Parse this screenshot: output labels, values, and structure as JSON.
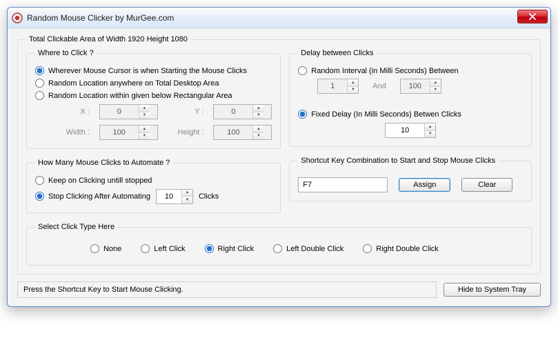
{
  "window": {
    "title": "Random Mouse Clicker by MurGee.com"
  },
  "mainGroup": {
    "legend": "Total Clickable Area of Width 1920 Height 1080"
  },
  "where": {
    "legend": "Where to Click ?",
    "opt1": "Wherever Mouse Cursor is when Starting the Mouse Clicks",
    "opt2": "Random Location anywhere on Total Desktop Area",
    "opt3": "Random Location within given below Rectangular Area",
    "xLabel": "X :",
    "yLabel": "Y :",
    "wLabel": "Width :",
    "hLabel": "Height :",
    "x": "0",
    "y": "0",
    "w": "100",
    "h": "100"
  },
  "delay": {
    "legend": "Delay between Clicks",
    "optRandom": "Random Interval (in Milli Seconds) Between",
    "andLabel": "And",
    "min": "1",
    "max": "100",
    "optFixed": "Fixed Delay (In Milli Seconds) Betwen Clicks",
    "fixed": "10"
  },
  "howMany": {
    "legend": "How Many Mouse Clicks to Automate ?",
    "optKeep": "Keep on Clicking untill stopped",
    "optStop": "Stop Clicking After Automating",
    "count": "10",
    "clicksLabel": "Clicks"
  },
  "shortcut": {
    "legend": "Shortcut Key Combination to Start and Stop Mouse Clicks",
    "value": "F7",
    "assign": "Assign",
    "clear": "Clear"
  },
  "clickType": {
    "legend": "Select Click Type Here",
    "none": "None",
    "left": "Left Click",
    "right": "Right Click",
    "leftDbl": "Left Double Click",
    "rightDbl": "Right Double Click"
  },
  "status": {
    "text": "Press the Shortcut Key to Start Mouse Clicking.",
    "hideBtn": "Hide to System Tray"
  }
}
